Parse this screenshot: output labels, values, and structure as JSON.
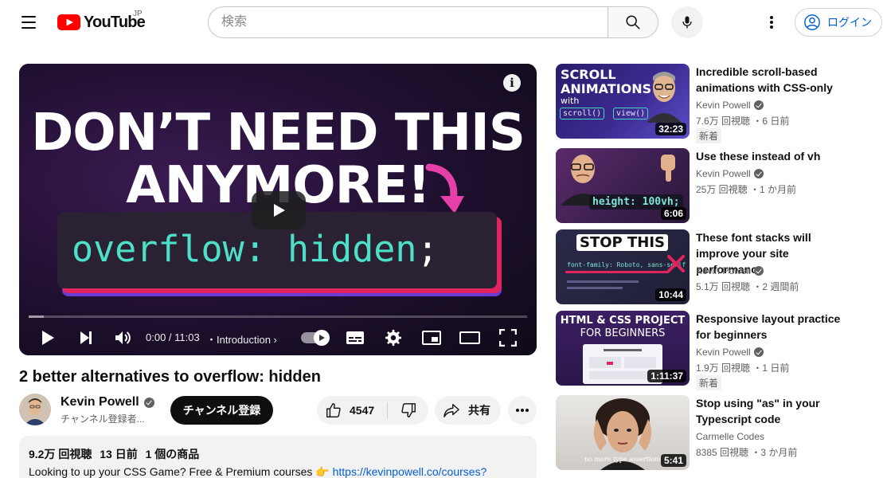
{
  "header": {
    "logo_text": "YouTube",
    "region": "JP",
    "search_placeholder": "検索",
    "login_label": "ログイン"
  },
  "player": {
    "thumb_line1": "DON’T NEED THIS",
    "thumb_line2": "ANYMORE!",
    "code_property": "overflow:",
    "code_value": "hidden",
    "code_semicolon": ";",
    "time": "0:00 / 11:03",
    "chapter": "・Introduction",
    "progress_buffered_pct": 3
  },
  "video": {
    "title": "2 better alternatives to overflow: hidden",
    "channel": "Kevin Powell",
    "subscribers": "チャンネル登録者...",
    "subscribe_label": "チャンネル登録",
    "likes": "4547",
    "share_label": "共有",
    "views": "9.2万 回視聴",
    "date": "13 日前",
    "products": "1 個の商品",
    "description": "Looking to up your CSS Game? Free & Premium courses 👉 ",
    "description_link": "https://kevinpowell.co/courses?"
  },
  "recommendations": [
    {
      "title": "Incredible scroll-based animations with CSS-only",
      "channel": "Kevin Powell",
      "verified": true,
      "meta": "7.6万 回視聴 ・6 日前",
      "badge": "新着",
      "duration": "32:23",
      "thumb_text": [
        "SCROLL",
        "ANIMATIONS",
        "with",
        "scroll()",
        "view()"
      ]
    },
    {
      "title": "Use these instead of vh",
      "channel": "Kevin Powell",
      "verified": true,
      "meta": "25万 回視聴 ・1 か月前",
      "badge": "",
      "duration": "6:06",
      "thumb_text": [
        "height: 100vh;"
      ]
    },
    {
      "title": "These font stacks will improve your site performance",
      "channel": "Kevin Powell",
      "verified": true,
      "meta": "5.1万 回視聴 ・2 週間前",
      "badge": "",
      "duration": "10:44",
      "thumb_text": [
        "STOP THIS",
        "font-family: Roboto, sans-serif"
      ]
    },
    {
      "title": "Responsive layout practice for beginners",
      "channel": "Kevin Powell",
      "verified": true,
      "meta": "1.9万 回視聴 ・1 日前",
      "badge": "新着",
      "duration": "1:11:37",
      "thumb_text": [
        "HTML & CSS PROJECT",
        "FOR BEGINNERS"
      ]
    },
    {
      "title": "Stop using \"as\" in your Typescript code",
      "channel": "Carmelle Codes",
      "verified": false,
      "meta": "8385 回視聴 ・3 か月前",
      "badge": "",
      "duration": "5:41",
      "thumb_text": [
        "no more type assertions"
      ]
    }
  ],
  "colors": {
    "brand_red": "#ff0000",
    "link_blue": "#065fd4",
    "code_teal": "#4de0c8",
    "accent_pink": "#e0245e"
  }
}
